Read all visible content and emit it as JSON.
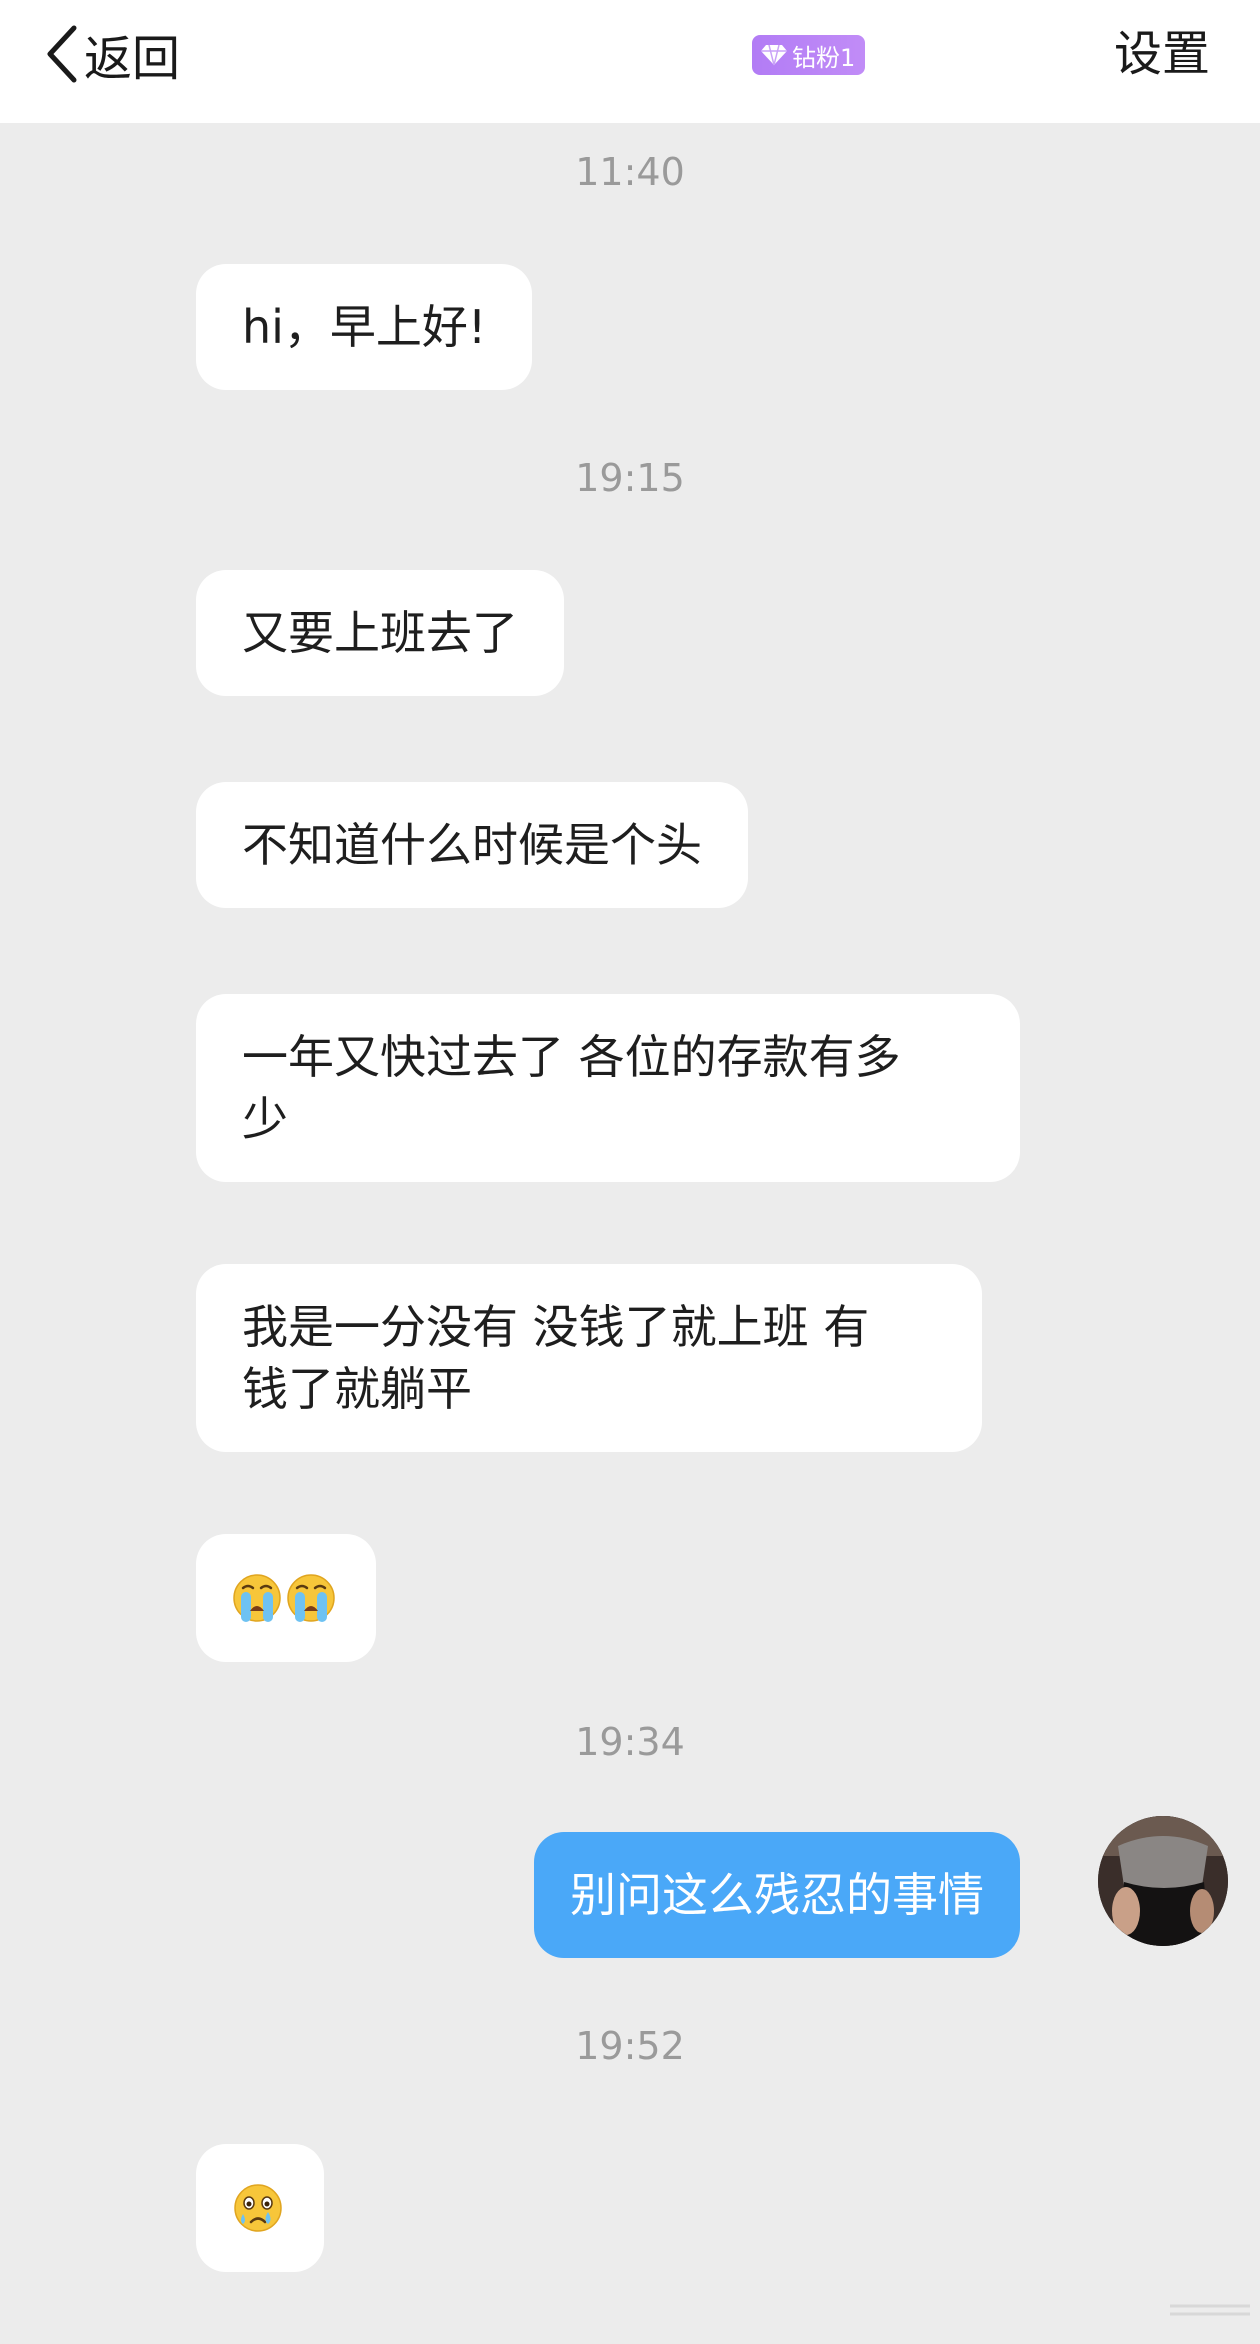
{
  "header": {
    "back_label": "返回",
    "badge_label": "钻粉1",
    "settings_label": "设置",
    "badge_color": "#b27cf5"
  },
  "messages": [
    {
      "type": "time",
      "text": "11:40"
    },
    {
      "type": "received",
      "text": "hi，早上好!"
    },
    {
      "type": "time",
      "text": "19:15"
    },
    {
      "type": "received",
      "text": "又要上班去了"
    },
    {
      "type": "received",
      "text": "不知道什么时候是个头"
    },
    {
      "type": "received",
      "lines": [
        "一年又快过去了 各位的存款有多",
        "少"
      ]
    },
    {
      "type": "received",
      "lines": [
        "我是一分没有 没钱了就上班 有",
        "钱了就躺平"
      ]
    },
    {
      "type": "received",
      "emoji": [
        "loudly-crying-face",
        "loudly-crying-face"
      ]
    },
    {
      "type": "time",
      "text": "19:34"
    },
    {
      "type": "sent",
      "text": "别问这么残忍的事情"
    },
    {
      "type": "time",
      "text": "19:52"
    },
    {
      "type": "received",
      "emoji": [
        "crying-face"
      ]
    }
  ],
  "colors": {
    "background": "#ececec",
    "sent_bubble": "#4aa8f8",
    "received_bubble": "#ffffff",
    "timestamp": "#9a9a9a"
  }
}
